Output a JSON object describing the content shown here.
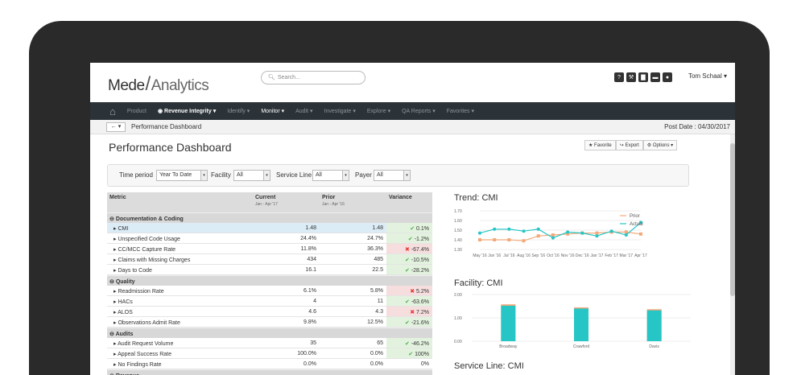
{
  "header": {
    "logo_left": "Mede",
    "logo_right": "Analytics",
    "search_placeholder": "Search...",
    "icons": [
      "question-icon",
      "wrench-icon",
      "bar-chart-icon",
      "chat-icon",
      "user-icon"
    ],
    "user_name": "Tom Schaal"
  },
  "nav": {
    "product": "Product",
    "revenue_integrity": "Revenue Integrity",
    "identify": "Identify",
    "monitor": "Monitor",
    "audit": "Audit",
    "investigate": "Investigate",
    "explore": "Explore",
    "qa_reports": "QA Reports",
    "favorites": "Favorites"
  },
  "breadcrumb": {
    "title": "Performance Dashboard",
    "post_date": "Post Date : 04/30/2017"
  },
  "page": {
    "title": "Performance Dashboard",
    "favorite": "Favorite",
    "export": "Export",
    "options": "Options"
  },
  "filters": {
    "time_period_label": "Time period",
    "time_period_value": "Year To Date",
    "facility_label": "Facility",
    "facility_value": "All",
    "service_line_label": "Service Line",
    "service_line_value": "All",
    "payer_label": "Payer",
    "payer_value": "All"
  },
  "table": {
    "headers": {
      "metric": "Metric",
      "current": "Current",
      "current_sub": "Jan - Apr '17",
      "prior": "Prior",
      "prior_sub": "Jan - Apr '16",
      "variance": "Variance"
    },
    "groups": [
      {
        "name": "Documentation & Coding",
        "rows": [
          {
            "name": "CMI",
            "current": "1.48",
            "prior": "1.48",
            "variance": "0.1%",
            "dir": "up",
            "selected": true
          },
          {
            "name": "Unspecified Code Usage",
            "current": "24.4%",
            "prior": "24.7%",
            "variance": "-1.2%",
            "dir": "up"
          },
          {
            "name": "CC/MCC Capture Rate",
            "current": "11.8%",
            "prior": "36.3%",
            "variance": "-67.4%",
            "dir": "dn"
          },
          {
            "name": "Claims with Missing Charges",
            "current": "434",
            "prior": "485",
            "variance": "-10.5%",
            "dir": "up"
          },
          {
            "name": "Days to Code",
            "current": "16.1",
            "prior": "22.5",
            "variance": "-28.2%",
            "dir": "up"
          }
        ]
      },
      {
        "name": "Quality",
        "rows": [
          {
            "name": "Readmission Rate",
            "current": "6.1%",
            "prior": "5.8%",
            "variance": "5.2%",
            "dir": "dn"
          },
          {
            "name": "HACs",
            "current": "4",
            "prior": "11",
            "variance": "-63.6%",
            "dir": "up"
          },
          {
            "name": "ALOS",
            "current": "4.6",
            "prior": "4.3",
            "variance": "7.2%",
            "dir": "dn"
          },
          {
            "name": "Observations Admit Rate",
            "current": "9.8%",
            "prior": "12.5%",
            "variance": "-21.6%",
            "dir": "up"
          }
        ]
      },
      {
        "name": "Audits",
        "rows": [
          {
            "name": "Audit Request Volume",
            "current": "35",
            "prior": "65",
            "variance": "-46.2%",
            "dir": "up"
          },
          {
            "name": "Appeal Success Rate",
            "current": "100.0%",
            "prior": "0.0%",
            "variance": "100%",
            "dir": "up"
          },
          {
            "name": "No Findings Rate",
            "current": "0.0%",
            "prior": "0.0%",
            "variance": "0%",
            "dir": "nt"
          }
        ]
      },
      {
        "name": "Revenue",
        "rows": []
      }
    ]
  },
  "colors": {
    "actual": "#26c6c6",
    "prior": "#f4a97b",
    "nav_bg": "#2b3238"
  },
  "chart_data": [
    {
      "type": "line",
      "title": "Trend: CMI",
      "x": [
        "May '16",
        "Jun '16",
        "Jul '16",
        "Aug '16",
        "Sep '16",
        "Oct '16",
        "Nov '16",
        "Dec '16",
        "Jan '17",
        "Feb '17",
        "Mar '17",
        "Apr '17"
      ],
      "ylim": [
        1.3,
        1.7
      ],
      "yticks": [
        "1.70",
        "1.60",
        "1.50",
        "1.40",
        "1.30"
      ],
      "legend_position": "top-right",
      "series": [
        {
          "name": "Prior",
          "values": [
            1.4,
            1.4,
            1.4,
            1.39,
            1.44,
            1.45,
            1.46,
            1.47,
            1.47,
            1.48,
            1.48,
            1.46
          ]
        },
        {
          "name": "Actual",
          "values": [
            1.47,
            1.51,
            1.51,
            1.49,
            1.51,
            1.42,
            1.48,
            1.47,
            1.44,
            1.49,
            1.45,
            1.58
          ]
        }
      ]
    },
    {
      "type": "bar",
      "title": "Facility: CMI",
      "categories": [
        "Broadway",
        "Crawford",
        "Davis"
      ],
      "ylim": [
        0,
        2.0
      ],
      "yticks": [
        "2.00",
        "1.00",
        "0.00"
      ],
      "series": [
        {
          "name": "Actual",
          "values": [
            1.52,
            1.4,
            1.32
          ]
        },
        {
          "name": "Prior",
          "values": [
            1.58,
            1.45,
            1.37
          ]
        }
      ]
    },
    {
      "type": "bar",
      "title": "Service Line: CMI"
    }
  ]
}
